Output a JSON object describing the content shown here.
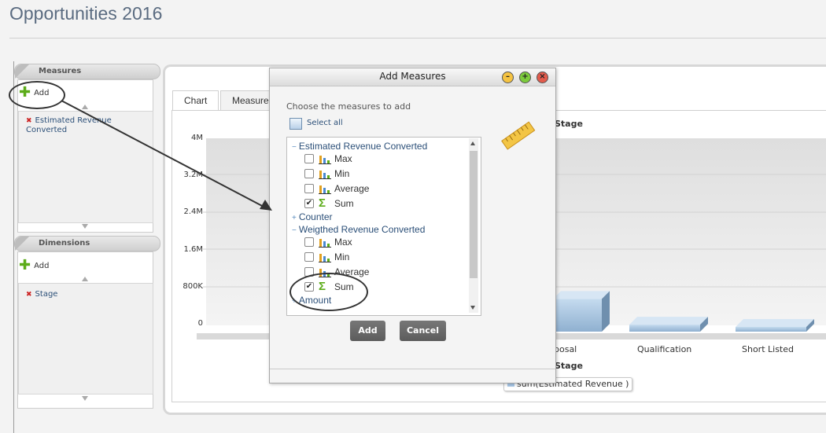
{
  "page": {
    "title": "Opportunities 2016"
  },
  "measures_panel": {
    "header": "Measures",
    "add_label": "Add",
    "items": [
      "Estimated Revenue Converted"
    ]
  },
  "dimensions_panel": {
    "header": "Dimensions",
    "add_label": "Add",
    "items": [
      "Stage"
    ]
  },
  "chart_tabs": [
    "Chart",
    "Measure"
  ],
  "chart_data": {
    "type": "bar",
    "title": "Stage",
    "xlabel": "Stage",
    "y_ticks": [
      "4M",
      "3.2M",
      "2.4M",
      "1.6M",
      "800K",
      "0"
    ],
    "ylim": [
      0,
      4000000
    ],
    "categories": [
      "Proposal",
      "Qualification",
      "Short Listed"
    ],
    "category_labels_visible": [
      "posal",
      "Qualification",
      "Short Listed"
    ],
    "series": [
      {
        "name": "sum(Estimated Revenue )",
        "values": [
          700000,
          150000,
          50000
        ]
      }
    ],
    "bar_color": "#a9c8e8",
    "legend_position": "bottom"
  },
  "dialog": {
    "title": "Add Measures",
    "instruction": "Choose the measures to add",
    "select_all": "Select all",
    "groups": [
      {
        "label": "Estimated Revenue Converted",
        "expanded": true,
        "measures": [
          {
            "label": "Max",
            "checked": false,
            "icon": "bar-chart-icon"
          },
          {
            "label": "Min",
            "checked": false,
            "icon": "bar-chart-icon"
          },
          {
            "label": "Average",
            "checked": false,
            "icon": "bar-chart-icon"
          },
          {
            "label": "Sum",
            "checked": true,
            "icon": "sigma-icon"
          }
        ]
      },
      {
        "label": "Counter",
        "expanded": false
      },
      {
        "label": "Weigthed Revenue Converted",
        "expanded": true,
        "measures": [
          {
            "label": "Max",
            "checked": false,
            "icon": "bar-chart-icon"
          },
          {
            "label": "Min",
            "checked": false,
            "icon": "bar-chart-icon"
          },
          {
            "label": "Average",
            "checked": false,
            "icon": "bar-chart-icon"
          },
          {
            "label": "Sum",
            "checked": true,
            "icon": "sigma-icon"
          }
        ]
      },
      {
        "label": "Amount",
        "expanded": false
      }
    ],
    "add_button": "Add",
    "cancel_button": "Cancel"
  }
}
